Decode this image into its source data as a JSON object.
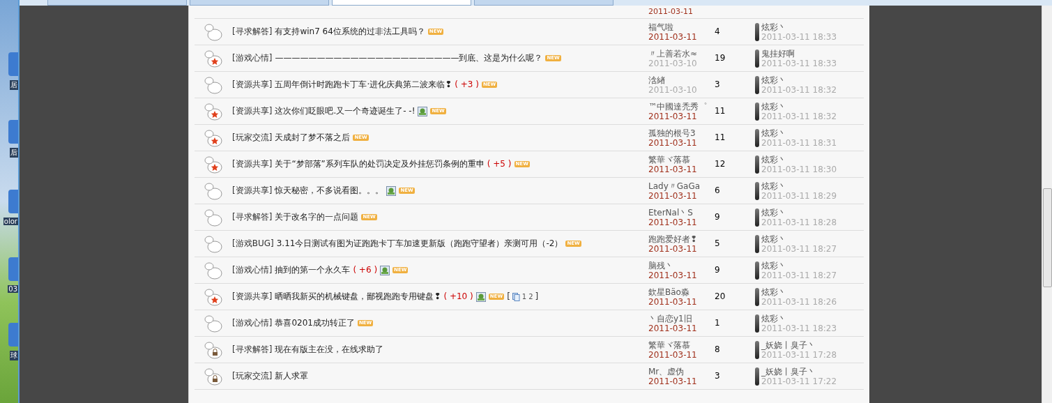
{
  "desktop": {
    "icons": [
      {
        "label": "居"
      },
      {
        "label": "后"
      },
      {
        "label": "olor"
      },
      {
        "label": "03"
      },
      {
        "label": "球"
      }
    ]
  },
  "browser": {
    "tabs": [
      {
        "selected": false
      },
      {
        "selected": false
      },
      {
        "selected": true
      },
      {
        "selected": false
      }
    ]
  },
  "thread_list": {
    "partial_row": {
      "date": "2011-03-11"
    },
    "rows": [
      {
        "kind": "normal",
        "category": "[寻求解答]",
        "title": "有支持win7 64位系统的过非法工具吗？",
        "new_badge": "NEW",
        "author": "福气啦",
        "date": "2011-03-11",
        "recent": true,
        "replies": "4",
        "last_author": "炫彩丶",
        "last_time": "2011-03-11 18:33"
      },
      {
        "kind": "hot",
        "category": "[游戏心情]",
        "title": "——————————————————————到底、这是为什么呢？",
        "new_badge": "NEW",
        "author": "〃上善若水≈",
        "date": "2011-03-10",
        "recent": false,
        "replies": "19",
        "last_author": "鬼挂好啊",
        "last_time": "2011-03-11 18:33"
      },
      {
        "kind": "normal",
        "category": "[资源共享]",
        "title": "五周年倒计时跑跑卡丁车·进化庆典第二波来临❢",
        "rating": "( +3 )",
        "new_badge": "NEW",
        "author": "浛緖",
        "date": "2011-03-10",
        "recent": false,
        "replies": "3",
        "last_author": "炫彩丶",
        "last_time": "2011-03-11 18:32"
      },
      {
        "kind": "hot",
        "category": "[资源共享]",
        "title": "这次你们眨眼吧.又一个奇迹诞生了- -!",
        "has_image": true,
        "new_badge": "NEW",
        "author": "™中國達禿秀゜",
        "date": "2011-03-11",
        "recent": true,
        "replies": "11",
        "last_author": "炫彩丶",
        "last_time": "2011-03-11 18:32"
      },
      {
        "kind": "hot",
        "category": "[玩家交流]",
        "title": "天成封了梦不落之后",
        "new_badge": "NEW",
        "author": "孤独的根号3",
        "date": "2011-03-11",
        "recent": true,
        "replies": "11",
        "last_author": "炫彩丶",
        "last_time": "2011-03-11 18:31"
      },
      {
        "kind": "hot",
        "category": "[资源共享]",
        "title": "关于“梦部落”系列车队的处罚决定及外挂惩罚条例的重申",
        "rating": "( +5 )",
        "new_badge": "NEW",
        "author": "繁華ヾ落慕",
        "date": "2011-03-11",
        "recent": true,
        "replies": "12",
        "last_author": "炫彩丶",
        "last_time": "2011-03-11 18:30"
      },
      {
        "kind": "normal",
        "category": "[资源共享]",
        "title": "惊天秘密，不多说看图。。。",
        "has_image": true,
        "new_badge": "NEW",
        "author": "Lady〃GaGa",
        "date": "2011-03-11",
        "recent": true,
        "replies": "6",
        "last_author": "炫彩丶",
        "last_time": "2011-03-11 18:29"
      },
      {
        "kind": "normal",
        "category": "[寻求解答]",
        "title": "关于改名字的一点问题",
        "new_badge": "NEW",
        "author": "EterNal丶S",
        "date": "2011-03-11",
        "recent": true,
        "replies": "9",
        "last_author": "炫彩丶",
        "last_time": "2011-03-11 18:28"
      },
      {
        "kind": "normal",
        "category": "[游戏BUG]",
        "title": "3.11今日测试有图为证跑跑卡丁车加速更新版（跑跑守望者）亲测可用（-2）",
        "new_badge": "NEW",
        "author": "跑跑爱好者❢",
        "date": "2011-03-11",
        "recent": true,
        "replies": "5",
        "last_author": "炫彩丶",
        "last_time": "2011-03-11 18:27"
      },
      {
        "kind": "normal",
        "category": "[游戏心情]",
        "title": "抽到的第一个永久车",
        "rating": "( +6 )",
        "has_image": true,
        "new_badge": "NEW",
        "author": "脑残丶",
        "date": "2011-03-11",
        "recent": true,
        "replies": "9",
        "last_author": "炫彩丶",
        "last_time": "2011-03-11 18:27"
      },
      {
        "kind": "hot",
        "category": "[资源共享]",
        "title": "晒晒我新买的机械键盘，鄙视跑跑专用键盘❢",
        "rating": "( +10 )",
        "has_image": true,
        "new_badge": "NEW",
        "pages_open": "[",
        "pages": [
          "1",
          "2"
        ],
        "pages_close": "]",
        "author": "欽星Bäo淼",
        "date": "2011-03-11",
        "recent": true,
        "replies": "20",
        "last_author": "炫彩丶",
        "last_time": "2011-03-11 18:26"
      },
      {
        "kind": "normal",
        "category": "[游戏心情]",
        "title": "恭喜0201成功转正了",
        "new_badge": "NEW",
        "author": "丶自恋y1旧",
        "date": "2011-03-11",
        "recent": true,
        "replies": "1",
        "last_author": "炫彩丶",
        "last_time": "2011-03-11 18:23"
      },
      {
        "kind": "locked",
        "category": "[寻求解答]",
        "title": "现在有版主在没，在线求助了",
        "author": "繁華ヾ落慕",
        "date": "2011-03-11",
        "recent": true,
        "replies": "8",
        "last_author": "_妖娆丨臭子丶",
        "last_time": "2011-03-11 17:28"
      },
      {
        "kind": "locked",
        "category": "[玩家交流]",
        "title": "新人求罩",
        "author": "Mr、虚伪",
        "date": "2011-03-11",
        "recent": true,
        "replies": "3",
        "last_author": "_妖娆丨臭子丶",
        "last_time": "2011-03-11 17:22"
      }
    ]
  }
}
